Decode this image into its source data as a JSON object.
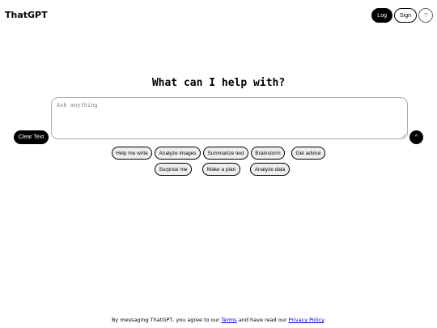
{
  "app": {
    "title": "ThatGPT"
  },
  "header": {
    "login_label": "Log",
    "signup_label": "Sign",
    "help_label": "?"
  },
  "main": {
    "headline": "What can I help with?",
    "input_placeholder": "Ask anything",
    "input_value": "",
    "clear_label": "Clear Text",
    "send_label": "^"
  },
  "suggestions": [
    "Help me write",
    "Analyze images",
    "Summarize text",
    "Brainstorm",
    "Get advice",
    "Surprise me",
    "Make a plan",
    "Analyze data"
  ],
  "footer": {
    "prefix": "By messaging ThatGPT, you agree to our ",
    "terms": "Terms",
    "middle": " and have read our ",
    "privacy": "Privacy Policy",
    "suffix": "."
  }
}
